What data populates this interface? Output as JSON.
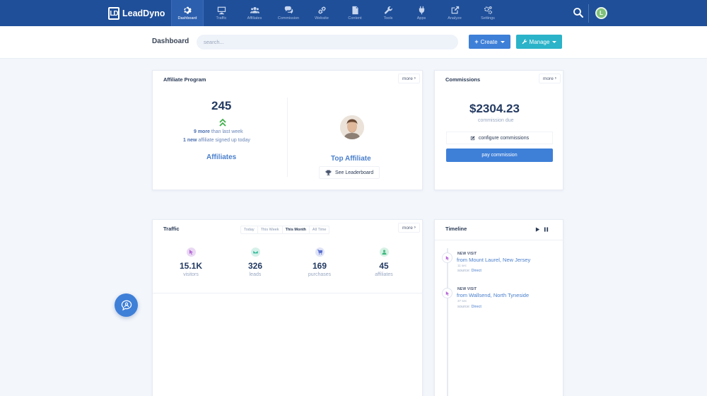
{
  "app": {
    "name": "LeadDyno",
    "logo_mark": "LD"
  },
  "nav": {
    "items": [
      {
        "label": "Dashboard",
        "icon": "gear-icon",
        "active": true
      },
      {
        "label": "Traffic",
        "icon": "monitor-icon"
      },
      {
        "label": "Affiliates",
        "icon": "users-icon"
      },
      {
        "label": "Commission",
        "icon": "comments-icon"
      },
      {
        "label": "Website",
        "icon": "link-icon"
      },
      {
        "label": "Content",
        "icon": "document-icon"
      },
      {
        "label": "Tools",
        "icon": "wrench-icon"
      },
      {
        "label": "Apps",
        "icon": "plug-icon"
      },
      {
        "label": "Analyze",
        "icon": "external-link-icon"
      },
      {
        "label": "Settings",
        "icon": "cogs-icon"
      }
    ],
    "avatar_initial": "L"
  },
  "header": {
    "title": "Dashboard",
    "search_placeholder": "search...",
    "create_label": "Create",
    "manage_label": "Manage"
  },
  "affiliate_program": {
    "title": "Affiliate Program",
    "more": "more",
    "count": "245",
    "more_count": "9 more",
    "more_suffix": "than last week",
    "new_count": "1 new",
    "new_suffix": "affiliate signed up today",
    "affiliates_link": "Affiliates",
    "top_affiliate": "Top Affiliate",
    "leaderboard": "See Leaderboard"
  },
  "commissions": {
    "title": "Commissions",
    "more": "more",
    "amount": "$2304.23",
    "due_label": "commission due",
    "configure": "configure commissions",
    "pay": "pay commission"
  },
  "traffic": {
    "title": "Traffic",
    "more": "more",
    "filters": [
      "Today",
      "This Week",
      "This Month",
      "All Time"
    ],
    "active_filter": "This Month",
    "stats": [
      {
        "value": "15.1K",
        "label": "visitors",
        "icon": "cursor-icon",
        "color": "#e9d8f3",
        "icon_color": "#b66ad6"
      },
      {
        "value": "326",
        "label": "leads",
        "icon": "envelope-icon",
        "color": "#d5f1ea",
        "icon_color": "#35b99a"
      },
      {
        "value": "169",
        "label": "purchases",
        "icon": "cart-icon",
        "color": "#dfe4f7",
        "icon_color": "#5a6fd0"
      },
      {
        "value": "45",
        "label": "affiliates",
        "icon": "user-icon",
        "color": "#d5f1e4",
        "icon_color": "#3fb87f"
      }
    ]
  },
  "timeline": {
    "title": "Timeline",
    "events": [
      {
        "kind": "NEW VISIT",
        "place": "from Mount Laurel, New Jersey",
        "ago": "11 sec",
        "source_label": "source:",
        "source": "Direct"
      },
      {
        "kind": "NEW VISIT",
        "place": "from Wallsend, North Tyneside",
        "ago": "37 sec",
        "source_label": "source:",
        "source": "Direct"
      }
    ]
  },
  "colors": {
    "nav_bg": "#1f4f99",
    "primary": "#3e7fd8",
    "teal": "#2ab3c9"
  }
}
